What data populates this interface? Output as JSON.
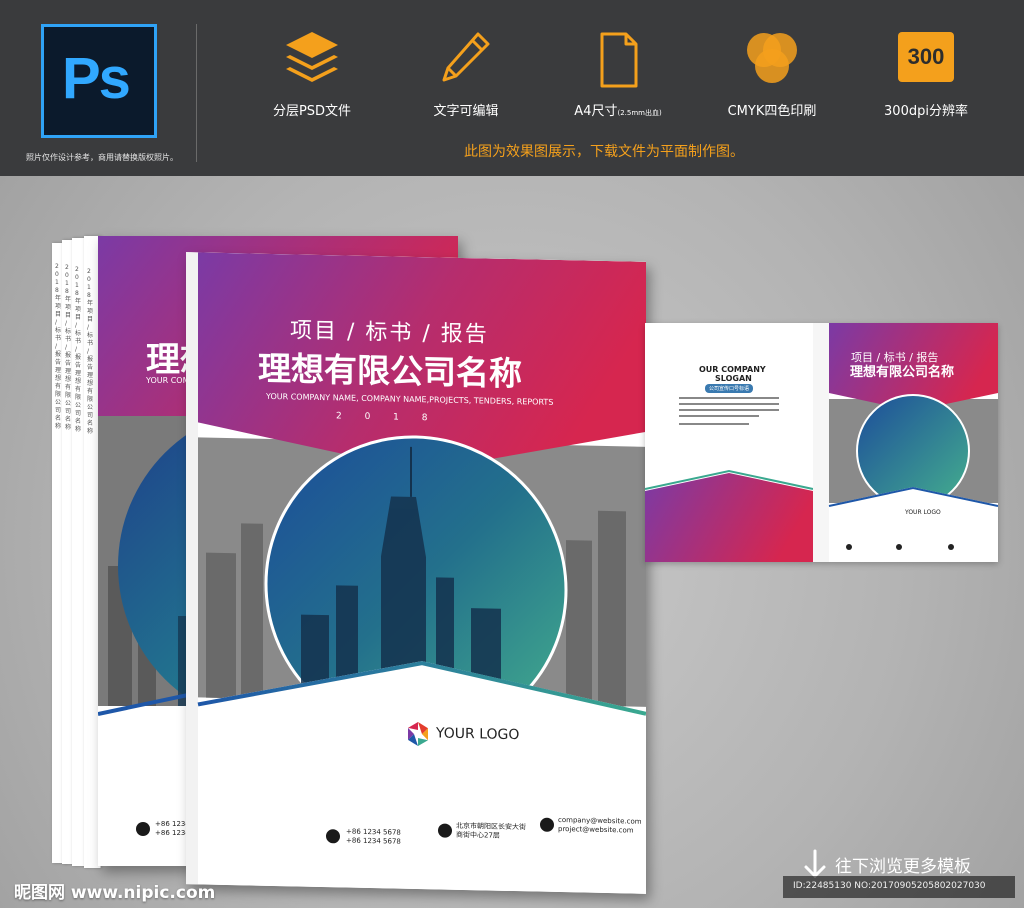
{
  "header": {
    "ps_logo_text": "Ps",
    "ps_note": "照片仅作设计参考，商用请替换版权照片。",
    "features": [
      {
        "icon": "layers-icon",
        "label": "分层PSD文件"
      },
      {
        "icon": "pencil-icon",
        "label": "文字可编辑"
      },
      {
        "icon": "page-icon",
        "label": "A4尺寸",
        "note": "(2.5mm出血)"
      },
      {
        "icon": "cmyk-circles-icon",
        "label": "CMYK四色印刷"
      },
      {
        "icon": "dpi-badge-icon",
        "badge": "300",
        "label": "300dpi分辨率"
      }
    ],
    "notice": "此图为效果图展示，下载文件为平面制作图。"
  },
  "cover": {
    "subtitle_cn": "项目 / 标书 / 报告",
    "title_cn": "理想有限公司名称",
    "subtitle_en": "YOUR COMPANY NAME, COMPANY NAME,PROJECTS, TENDERS, REPORTS",
    "year": "2 0 1 8",
    "logo_text": "YOUR LOGO",
    "phone": "+86 1234 5678\n+86 1234 5678",
    "address": "北京市朝阳区长安大街\n商街中心27层",
    "email": "company@website.com\nproject@website.com",
    "spine": "2018年 项目 / 标书 / 报告 理想有限公司名称"
  },
  "back_cover": {
    "company": "OUR COMPANY",
    "slogan": "SLOGAN",
    "tag": "公司宣传口号标语"
  },
  "colors": {
    "purple": "#7b3aa5",
    "magenta": "#d6264f",
    "teal": "#3aa88f",
    "blue": "#1e57a8",
    "accent_orange": "#f4a01c",
    "bg_top": "#3a3b3d"
  },
  "footer": {
    "site": "昵图网 www.nipic.com",
    "more": "往下浏览更多模板",
    "id": "ID:22485130 NO:20170905205802027030"
  }
}
